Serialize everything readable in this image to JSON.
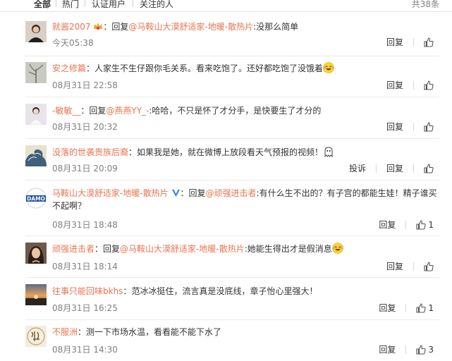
{
  "tabs": {
    "items": [
      "全部",
      "热门",
      "认证用户",
      "关注的人"
    ],
    "total": "共38条"
  },
  "comments": [
    {
      "user": "就酱2007",
      "reply_prefix": "回复",
      "reply_to": "@马鞍山大漠舒适家-地暖-散热片",
      "text": ":没那么简单",
      "date": "今天05:38",
      "reply_label": "回复",
      "avatar": "woman-portrait"
    },
    {
      "user": "安之修篇",
      "text": "人家生不生仔跟你毛关系。看来吃饱了。还好都吃饱了没饿着",
      "date": "08月31日 22:58",
      "reply_label": "回复",
      "avatar": "plant-photo"
    },
    {
      "user": "-敏敏__",
      "reply_prefix": "回复",
      "reply_to": "@燕燕YY_-",
      "text": ":哈哈，不只是怀了才分手，是快要生了才分的",
      "date": "08月31日 20:32",
      "reply_label": "回复",
      "avatar": "woman-white"
    },
    {
      "user": "没落的世袭贵族后裔",
      "text": "如果我是她，就在微博上放段看天气预报的视频！",
      "date": "08月31日 20:09",
      "report_label": "投诉",
      "reply_label": "回复",
      "avatar": "wave-art"
    },
    {
      "user": "马鞍山大漠舒适家-地暖-散热片",
      "reply_prefix": "回复",
      "reply_to": "@顽强进击者",
      "text": ":有什么生不出的？有子宫的都能生娃！精子谁买不起啊？",
      "date": "08月31日 18:48",
      "reply_label": "回复",
      "likes": "1",
      "avatar": "damo-logo",
      "avatar_text": "DAMO"
    },
    {
      "user": "顽强进击者",
      "reply_prefix": "回复",
      "reply_to": "@马鞍山大漠舒适家-地暖-散热片",
      "text": ":她能生得出才是假消息",
      "date": "08月31日 18:14",
      "reply_label": "回复",
      "avatar": "girl-portrait"
    },
    {
      "user": "往事只能回味bkhs",
      "text": "范冰冰挺住，流言真是没底线，章子怡心里强大！",
      "date": "08月31日 16:25",
      "reply_label": "回复",
      "likes": "1",
      "avatar": "sunset-photo"
    },
    {
      "user": "不服洲",
      "text": "测一下市场水温，看看能不能下水了",
      "date": "08月31日 14:30",
      "reply_label": "回复",
      "likes": "3",
      "avatar": "calligraphy-seal"
    }
  ],
  "colors": {
    "username": "#eb7350",
    "link": "#eb7350",
    "muted": "#808080",
    "text": "#333333",
    "divider": "#ececec",
    "vip_badge": "#2b7de0"
  }
}
